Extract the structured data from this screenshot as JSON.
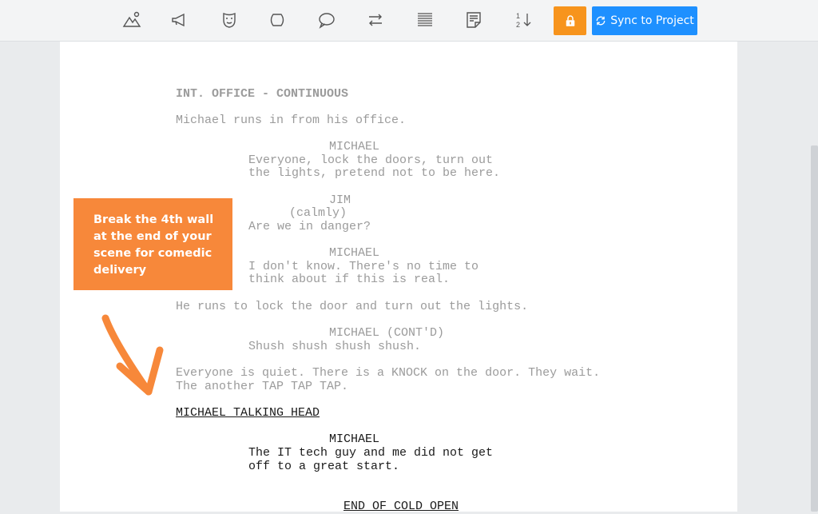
{
  "toolbar": {
    "tools": [
      {
        "name": "scene-image-icon",
        "label": "Scene image"
      },
      {
        "name": "megaphone-icon",
        "label": "Announce"
      },
      {
        "name": "mask-icon",
        "label": "Character"
      },
      {
        "name": "oval-icon",
        "label": "Shape"
      },
      {
        "name": "speech-bubble-icon",
        "label": "Dialogue"
      },
      {
        "name": "swap-arrows-icon",
        "label": "Transition"
      },
      {
        "name": "lines-icon",
        "label": "Action"
      },
      {
        "name": "note-icon",
        "label": "Note"
      },
      {
        "name": "sort-numeric-icon",
        "label": "Scene numbers"
      }
    ],
    "sync_label": "Sync to Project",
    "accent_color": "#f7941d",
    "sync_color": "#1e90ff"
  },
  "script": {
    "scene_heading": "INT. OFFICE - CONTINUOUS",
    "action_1": "Michael runs in from his office.",
    "char_1": "MICHAEL",
    "dial_1a": "Everyone, lock the doors, turn out",
    "dial_1b": "the lights, pretend not to be here.",
    "char_2": "JIM",
    "paren_2": "(calmly)",
    "dial_2": "Are we in danger?",
    "char_3": "MICHAEL",
    "dial_3a": "I don't know. There's no time to",
    "dial_3b": "think about if this is real.",
    "action_2": "He runs to lock the door and turn out the lights.",
    "char_4": "MICHAEL (CONT'D)",
    "dial_4": "Shush shush shush shush.",
    "action_3a": "Everyone is quiet. There is a KNOCK on the door. They wait.",
    "action_3b": "The another TAP TAP TAP.",
    "talking_head": "MICHAEL TALKING HEAD",
    "char_5": "MICHAEL",
    "dial_5a": "The IT tech guy and me did not get",
    "dial_5b": "off to a great start.",
    "end": "END OF COLD OPEN"
  },
  "callout": {
    "text": "Break the 4th wall at the end of your scene for comedic delivery",
    "color": "#f7883a"
  }
}
